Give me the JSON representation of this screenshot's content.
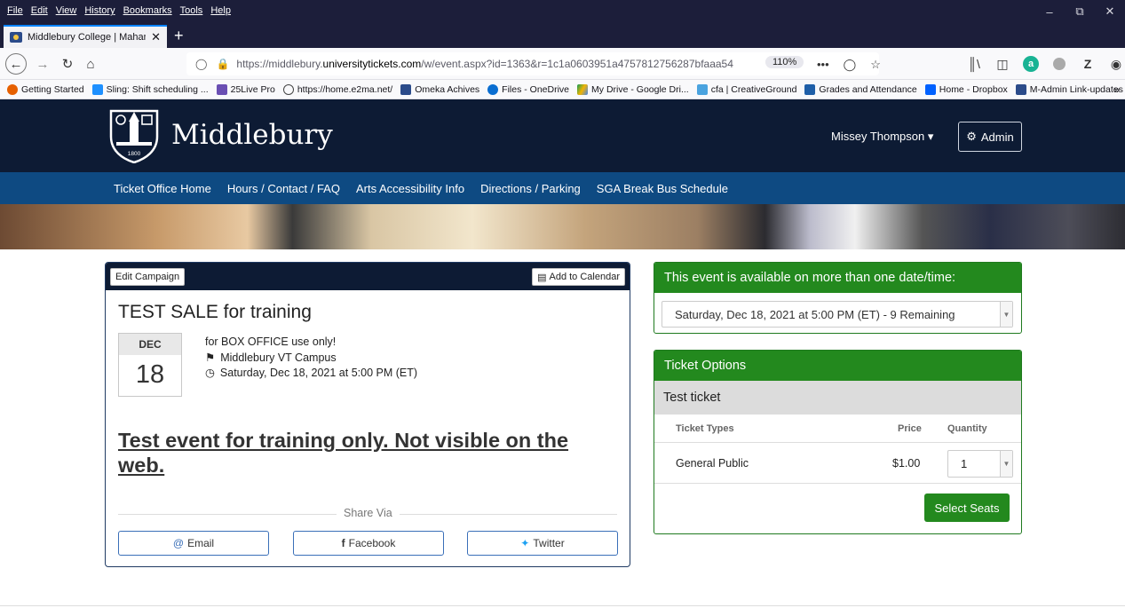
{
  "browser": {
    "menu": [
      "File",
      "Edit",
      "View",
      "History",
      "Bookmarks",
      "Tools",
      "Help"
    ],
    "tab_title": "Middlebury College | Mahaney",
    "url_prefix": "https://middlebury.",
    "url_domain": "universitytickets.com",
    "url_path": "/w/event.aspx?id=1363&r=1c1a0603951a4757812756287bfaaa54",
    "zoom": "110%",
    "bookmarks": [
      {
        "label": "Getting Started",
        "color": "#e66000"
      },
      {
        "label": "Sling: Shift scheduling ...",
        "color": "#1e90ff"
      },
      {
        "label": "25Live Pro",
        "color": "#6a4fb3"
      },
      {
        "label": "https://home.e2ma.net/",
        "color": "#444444"
      },
      {
        "label": "Omeka Achives",
        "color": "#2b4b8a"
      },
      {
        "label": "Files - OneDrive",
        "color": "#0a6ed1"
      },
      {
        "label": "My Drive - Google Dri...",
        "color": "#f4b400"
      },
      {
        "label": "cfa | CreativeGround",
        "color": "#4aa3df"
      },
      {
        "label": "Grades and Attendance",
        "color": "#1f5fa8"
      },
      {
        "label": "Home - Dropbox",
        "color": "#0061ff"
      },
      {
        "label": "M-Admin Link-updates",
        "color": "#2b4b8a"
      }
    ]
  },
  "header": {
    "site_name": "Middlebury",
    "logo_year": "1800",
    "user_name": "Missey Thompson",
    "admin_label": "Admin"
  },
  "nav": [
    "Ticket Office Home",
    "Hours / Contact / FAQ",
    "Arts Accessibility Info",
    "Directions / Parking",
    "SGA Break Bus Schedule"
  ],
  "event": {
    "edit_label": "Edit Campaign",
    "calendar_label": "Add to Calendar",
    "title": "TEST SALE for training",
    "month": "DEC",
    "day": "18",
    "note": "for BOX OFFICE use only!",
    "location": "Middlebury VT Campus",
    "datetime": "Saturday, Dec 18, 2021 at 5:00 PM (ET)",
    "description": "Test event for training only. Not visible on the web.",
    "share_label": "Share Via",
    "share": {
      "email": "Email",
      "facebook": "Facebook",
      "twitter": "Twitter"
    }
  },
  "dates_panel": {
    "title": "This event is available on more than one date/time:",
    "selected": "Saturday, Dec 18, 2021 at 5:00 PM (ET) - 9 Remaining"
  },
  "tickets_panel": {
    "title": "Ticket Options",
    "subtitle": "Test ticket",
    "headers": {
      "type": "Ticket Types",
      "price": "Price",
      "quantity": "Quantity"
    },
    "rows": [
      {
        "type": "General Public",
        "price": "$1.00",
        "quantity": "1"
      }
    ],
    "button": "Select Seats"
  },
  "colors": {
    "header": "#0d1b34",
    "nav": "#0e4a82",
    "green": "#23891e"
  }
}
